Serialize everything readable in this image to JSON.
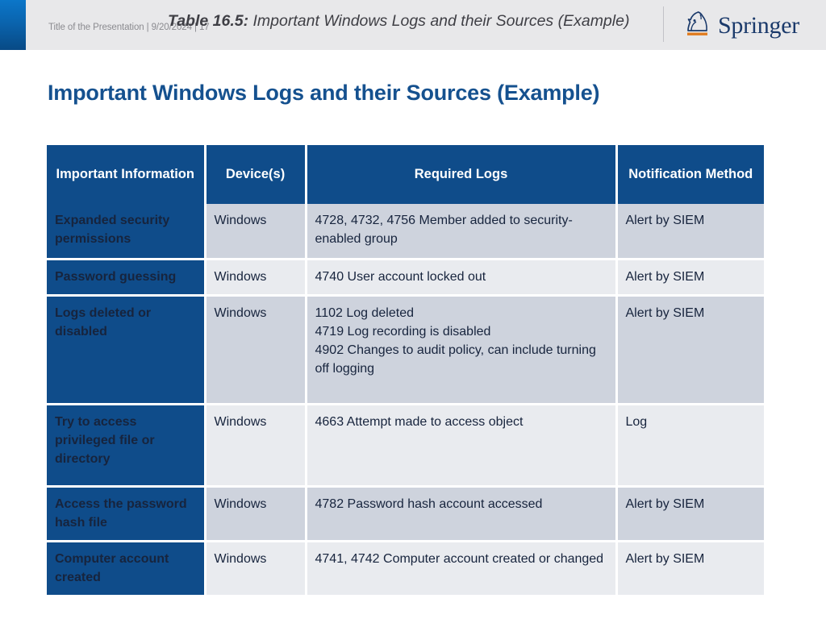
{
  "header": {
    "meta": "Title of the Presentation | 9/20/2024 | 17",
    "table_label": "Table 16.5:",
    "table_caption": "Important Windows Logs and their Sources (Example)",
    "logo_text": "Springer",
    "logo_icon": "springer-knight-icon",
    "accent_color": "#0a64ae",
    "divider_color": "#c2c2c8"
  },
  "slide": {
    "title": "Important Windows Logs and their Sources (Example)",
    "title_color": "#15518f"
  },
  "table": {
    "header_bg": "#0f4c8a",
    "first_col_bg": "#0f4c8a",
    "row_shade_dark": "#ced3dd",
    "row_shade_light": "#e9ebef",
    "columns": [
      "Important Information",
      "Device(s)",
      "Required Logs",
      "Notification Method"
    ],
    "rows": [
      {
        "information": "Expanded security permissions",
        "devices": "Windows",
        "logs": "4728, 4732, 4756 Member added to security-enabled group",
        "notification": "Alert by SIEM",
        "shade": "dark"
      },
      {
        "information": "Password guessing",
        "devices": "Windows",
        "logs": "4740 User account locked out",
        "notification": "Alert by SIEM",
        "shade": "light"
      },
      {
        "information": "Logs deleted or disabled",
        "devices": "Windows",
        "logs": "1102 Log deleted\n4719 Log recording is disabled\n4902 Changes to audit policy, can include turning off logging",
        "notification": "Alert by SIEM",
        "shade": "dark"
      },
      {
        "information": "Try to access privileged file or directory",
        "devices": "Windows",
        "logs": "4663 Attempt made to access object",
        "notification": "Log",
        "shade": "light"
      },
      {
        "information": "Access the password hash file",
        "devices": "Windows",
        "logs": "4782 Password hash account accessed",
        "notification": "Alert by SIEM",
        "shade": "dark"
      },
      {
        "information": "Computer account created",
        "devices": "Windows",
        "logs": "4741, 4742 Computer account created or changed",
        "notification": "Alert by SIEM",
        "shade": "light"
      }
    ]
  }
}
